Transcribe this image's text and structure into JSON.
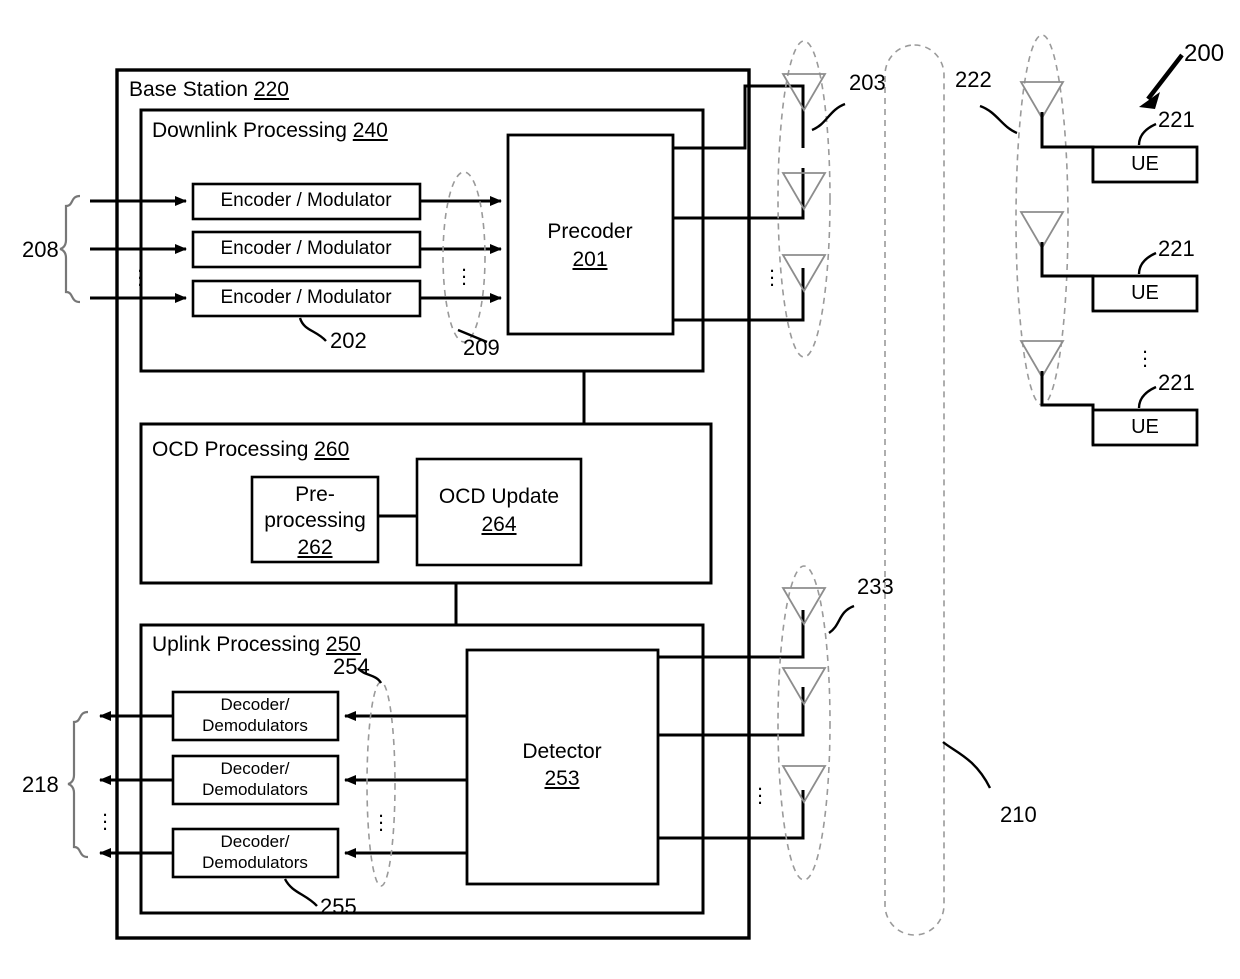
{
  "figure": {
    "number": "200",
    "domain": "telecom-block-diagram"
  },
  "base_station": {
    "title_text": "Base Station",
    "title_ref": "220"
  },
  "downlink": {
    "title_text": "Downlink Processing",
    "title_ref": "240",
    "encoder_label": "Encoder / Modulator",
    "encoders": [
      {
        "label": "Encoder / Modulator"
      },
      {
        "label": "Encoder / Modulator"
      },
      {
        "label": "Encoder / Modulator"
      }
    ],
    "encoder_ref": "202",
    "bus_ref": "209",
    "precoder": {
      "label": "Precoder",
      "ref": "201"
    },
    "input_bundle_ref": "208"
  },
  "ocd": {
    "title_text": "OCD Processing",
    "title_ref": "260",
    "preprocessing": {
      "line1": "Pre-",
      "line2": "processing",
      "ref": "262"
    },
    "update": {
      "label": "OCD Update",
      "ref": "264"
    }
  },
  "uplink": {
    "title_text": "Uplink Processing",
    "title_ref": "250",
    "decoder_label_line1": "Decoder/",
    "decoder_label_line2": "Demodulators",
    "decoders": [
      {
        "line1": "Decoder/",
        "line2": "Demodulators"
      },
      {
        "line1": "Decoder/",
        "line2": "Demodulators"
      },
      {
        "line1": "Decoder/",
        "line2": "Demodulators"
      }
    ],
    "decoder_ref": "255",
    "bus_ref": "254",
    "detector": {
      "label": "Detector",
      "ref": "253"
    },
    "output_bundle_ref": "218"
  },
  "antennas": {
    "downlink_array_ref": "203",
    "uplink_array_ref": "233",
    "ue_array_ref": "222"
  },
  "channel": {
    "ref": "210"
  },
  "ues": [
    {
      "label": "UE",
      "ref": "221"
    },
    {
      "label": "UE",
      "ref": "221"
    },
    {
      "label": "UE",
      "ref": "221"
    }
  ],
  "colors": {
    "line": "#000000",
    "dashed": "#9a9a9a",
    "antenna": "#8d8d8d",
    "background": "#ffffff"
  }
}
